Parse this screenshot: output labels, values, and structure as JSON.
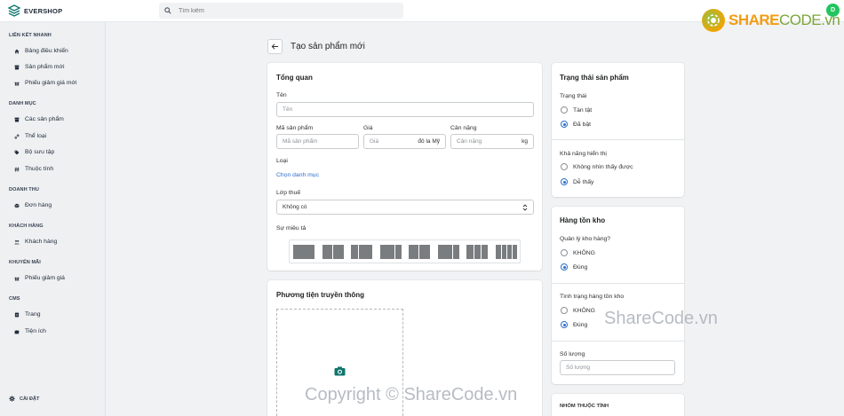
{
  "brand": {
    "name": "EVERSHOP"
  },
  "search": {
    "placeholder": "Tìm kiếm"
  },
  "user": {
    "initial": "D"
  },
  "watermarks": {
    "logo_left": "SHARE",
    "logo_right": "CODE.vn",
    "mid": "ShareCode.vn",
    "bottom": "Copyright © ShareCode.vn"
  },
  "sidebar": {
    "sections": [
      {
        "title": "LIÊN KẾT NHANH",
        "items": [
          {
            "label": "Bảng điều khiển",
            "icon": "home-icon"
          },
          {
            "label": "Sản phẩm mới",
            "icon": "archive-icon"
          },
          {
            "label": "Phiếu giảm giá mới",
            "icon": "gift-icon"
          }
        ]
      },
      {
        "title": "DANH MỤC",
        "items": [
          {
            "label": "Các sản phẩm",
            "icon": "archive-icon"
          },
          {
            "label": "Thể loại",
            "icon": "link-icon"
          },
          {
            "label": "Bộ sưu tập",
            "icon": "tag-icon"
          },
          {
            "label": "Thuộc tính",
            "icon": "hash-icon"
          }
        ]
      },
      {
        "title": "DOANH THU",
        "items": [
          {
            "label": "Đơn hàng",
            "icon": "cube-icon"
          }
        ]
      },
      {
        "title": "KHÁCH HÀNG",
        "items": [
          {
            "label": "Khách hàng",
            "icon": "users-icon"
          }
        ]
      },
      {
        "title": "KHUYẾN MÃI",
        "items": [
          {
            "label": "Phiếu giảm giá",
            "icon": "gift-icon"
          }
        ]
      },
      {
        "title": "CMS",
        "items": [
          {
            "label": "Trang",
            "icon": "document-icon"
          },
          {
            "label": "Tiện ích",
            "icon": "puzzle-icon"
          }
        ]
      }
    ],
    "settings_label": "CÀI ĐẶT"
  },
  "page": {
    "title": "Tạo sản phẩm mới"
  },
  "overview": {
    "title": "Tổng quan",
    "name_label": "Tên",
    "name_placeholder": "Tên",
    "sku_label": "Mã sản phẩm",
    "sku_placeholder": "Mã sản phẩm",
    "price_label": "Giá",
    "price_placeholder": "Giá",
    "price_suffix": "đô la Mỹ",
    "weight_label": "Cân nặng",
    "weight_placeholder": "Cân nặng",
    "weight_suffix": "kg",
    "category_label": "Loại",
    "category_link": "Chọn danh mục",
    "tax_label": "Lớp thuế",
    "tax_value": "Không có",
    "description_label": "Sự miêu tả"
  },
  "media": {
    "title": "Phương tiện truyền thông"
  },
  "status": {
    "title": "Trạng thái sản phẩm",
    "status_label": "Trạng thái",
    "status_options": [
      "Tàn tật",
      "Đã bật"
    ],
    "status_selected": 1,
    "visibility_label": "Khả năng hiển thị",
    "visibility_options": [
      "Không nhìn thấy được",
      "Dễ thấy"
    ],
    "visibility_selected": 1
  },
  "inventory": {
    "title": "Hàng tồn kho",
    "manage_label": "Quản lý kho hàng?",
    "manage_options": [
      "KHÔNG",
      "Đúng"
    ],
    "manage_selected": 1,
    "stock_label": "Tình trạng hàng tồn kho",
    "stock_options": [
      "KHÔNG",
      "Đúng"
    ],
    "stock_selected": 1,
    "qty_label": "Số lượng",
    "qty_placeholder": "Số lượng"
  },
  "attribute_group": {
    "title": "NHÓM THUỘC TÍNH"
  }
}
